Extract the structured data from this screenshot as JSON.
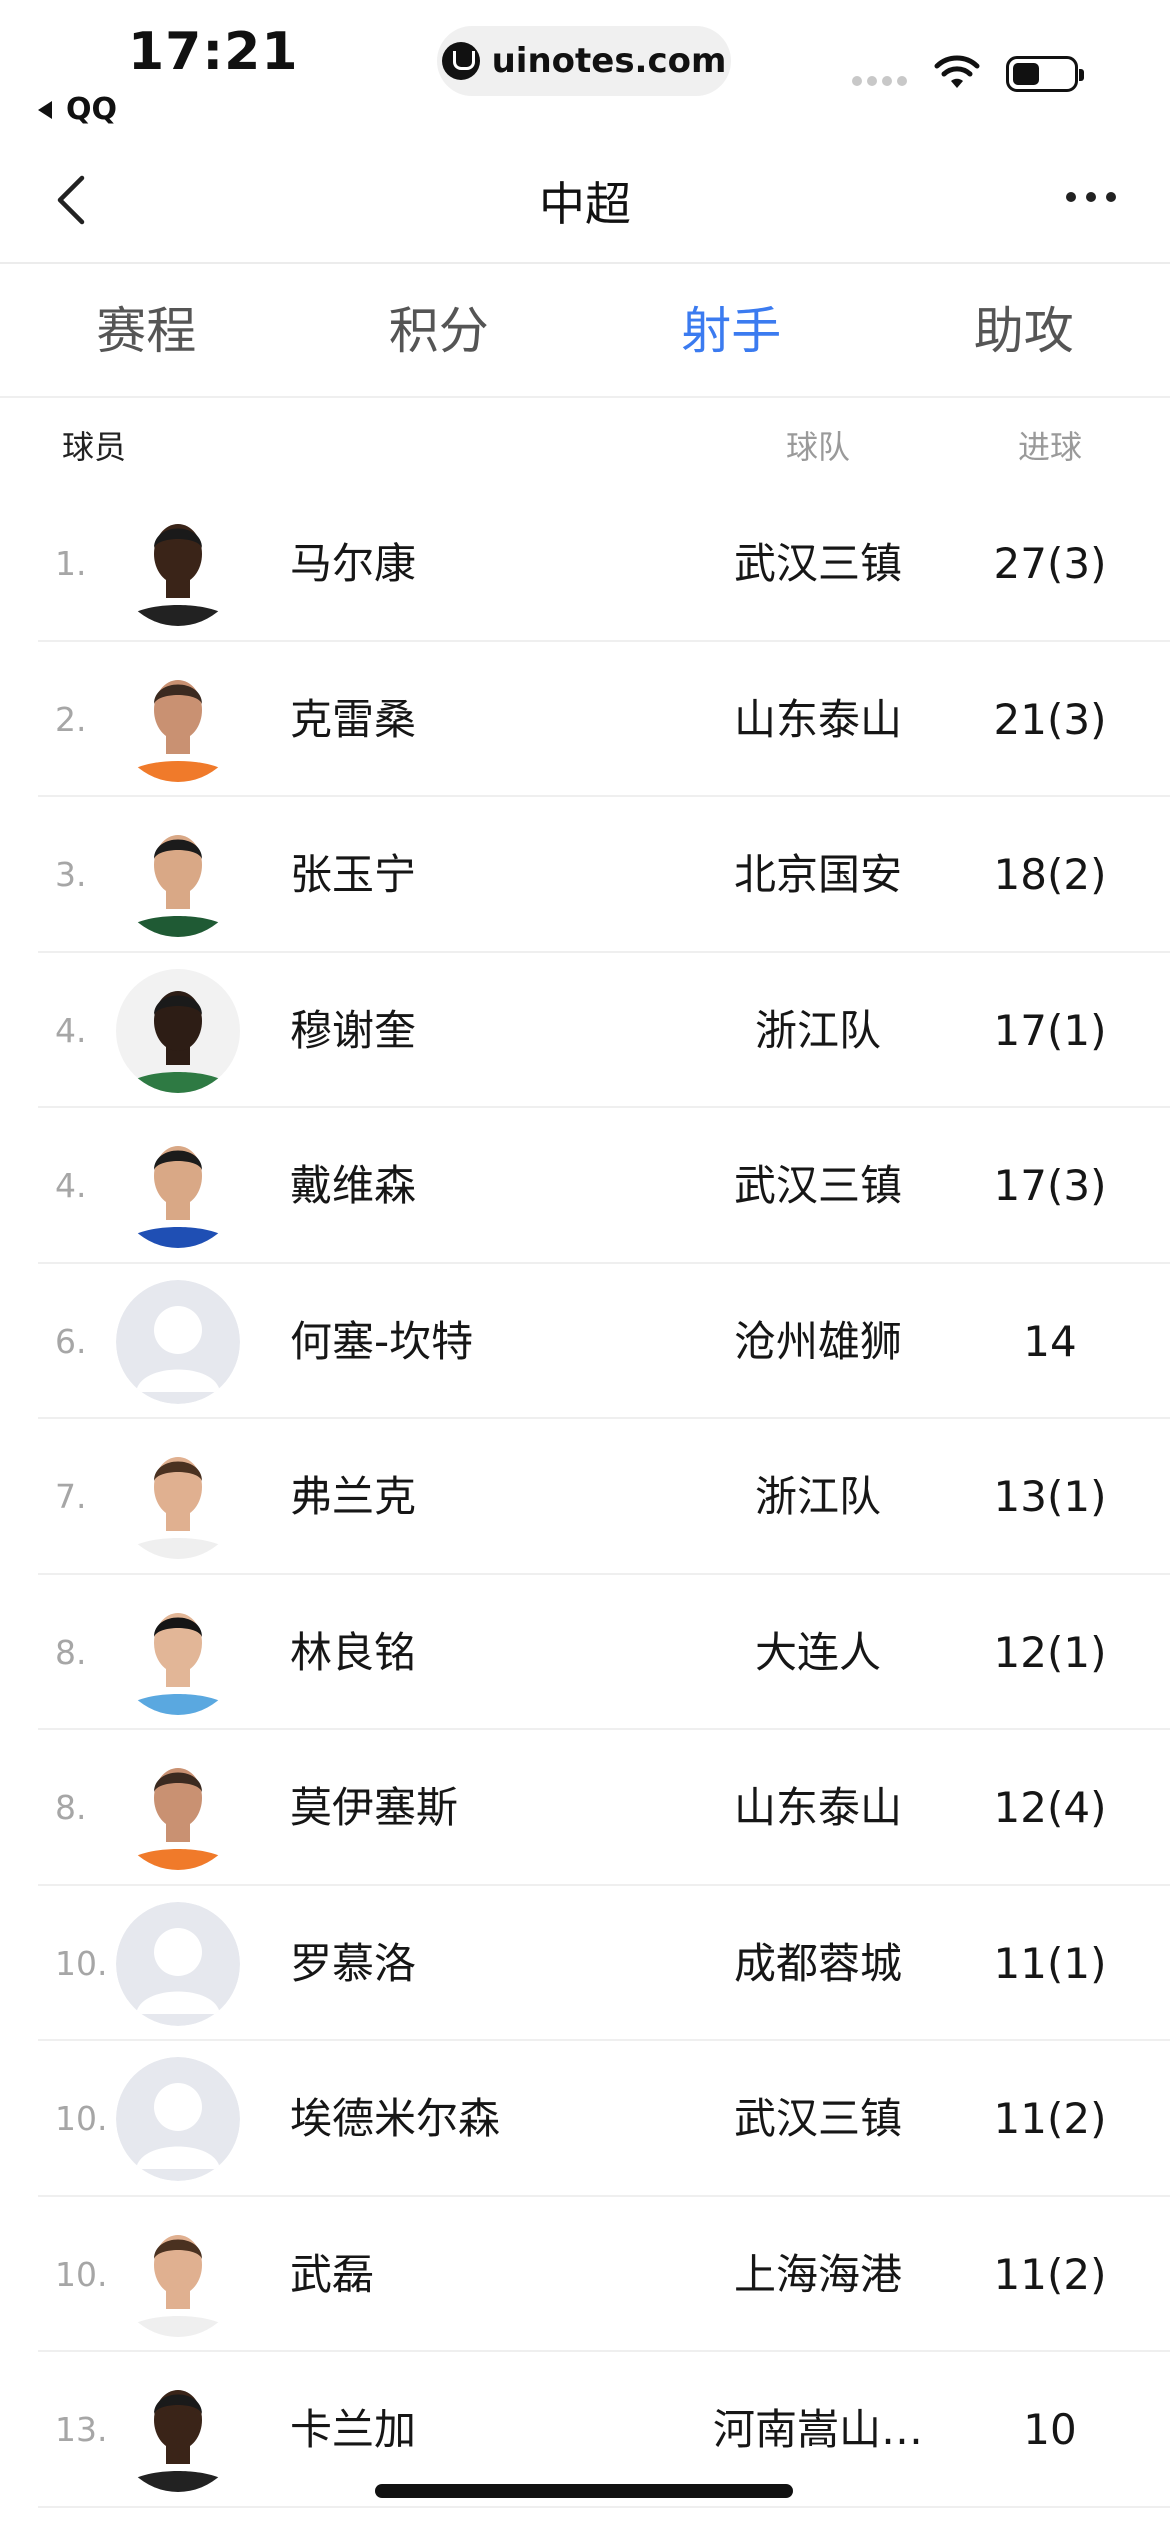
{
  "status_bar": {
    "time": "17:21",
    "back_app": "QQ",
    "url": "uinotes.com"
  },
  "nav": {
    "title": "中超"
  },
  "tabs": [
    {
      "label": "赛程",
      "active": false
    },
    {
      "label": "积分",
      "active": false
    },
    {
      "label": "射手",
      "active": true
    },
    {
      "label": "助攻",
      "active": false
    }
  ],
  "table_header": {
    "player": "球员",
    "team": "球队",
    "goals": "进球"
  },
  "rows": [
    {
      "rank": "1.",
      "name": "马尔康",
      "team": "武汉三镇",
      "goals": "27(3)",
      "avatar": "dark-skin-player"
    },
    {
      "rank": "2.",
      "name": "克雷桑",
      "team": "山东泰山",
      "goals": "21(3)",
      "avatar": "orange-kit-player"
    },
    {
      "rank": "3.",
      "name": "张玉宁",
      "team": "北京国安",
      "goals": "18(2)",
      "avatar": "green-kit-player"
    },
    {
      "rank": "4.",
      "name": "穆谢奎",
      "team": "浙江队",
      "goals": "17(1)",
      "avatar": "dark-skin-green-kit-player"
    },
    {
      "rank": "4.",
      "name": "戴维森",
      "team": "武汉三镇",
      "goals": "17(3)",
      "avatar": "blue-kit-player"
    },
    {
      "rank": "6.",
      "name": "何塞-坎特",
      "team": "沧州雄狮",
      "goals": "14",
      "avatar": "placeholder"
    },
    {
      "rank": "7.",
      "name": "弗兰克",
      "team": "浙江队",
      "goals": "13(1)",
      "avatar": "light-skin-player"
    },
    {
      "rank": "8.",
      "name": "林良铭",
      "team": "大连人",
      "goals": "12(1)",
      "avatar": "sky-blue-kit-player"
    },
    {
      "rank": "8.",
      "name": "莫伊塞斯",
      "team": "山东泰山",
      "goals": "12(4)",
      "avatar": "orange-kit-player"
    },
    {
      "rank": "10.",
      "name": "罗慕洛",
      "team": "成都蓉城",
      "goals": "11(1)",
      "avatar": "placeholder"
    },
    {
      "rank": "10.",
      "name": "埃德米尔森",
      "team": "武汉三镇",
      "goals": "11(2)",
      "avatar": "placeholder"
    },
    {
      "rank": "10.",
      "name": "武磊",
      "team": "上海海港",
      "goals": "11(2)",
      "avatar": "light-skin-player"
    },
    {
      "rank": "13.",
      "name": "卡兰加",
      "team": "河南嵩山…",
      "goals": "10",
      "avatar": "dark-skin-player"
    }
  ],
  "colors": {
    "accent": "#3b7bf0",
    "muted": "#a6a6a6",
    "divider": "#efefef"
  }
}
